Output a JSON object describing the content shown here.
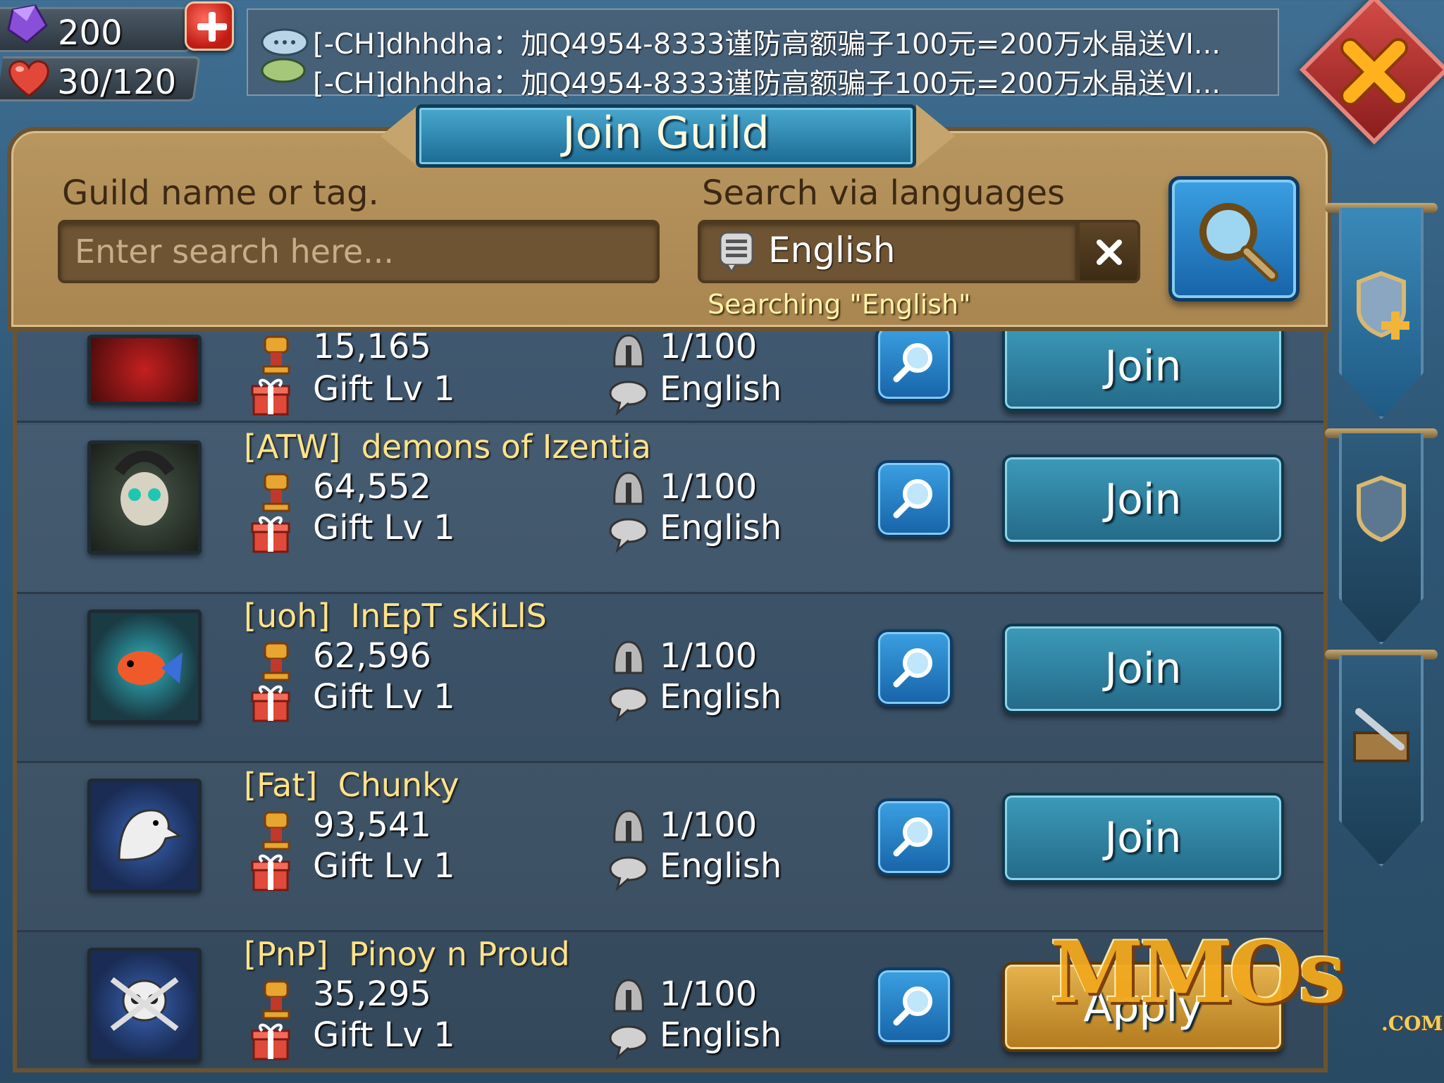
{
  "resources": {
    "gems": "200",
    "stamina": "30/120"
  },
  "chat": {
    "lines": [
      "[-CH]dhhdha：加Q4954-8333谨防高额骗子100元=200万水晶送VI...",
      "[-CH]dhhdha：加Q4954-8333谨防高额骗子100元=200万水晶送VI..."
    ]
  },
  "panel": {
    "title": "Join Guild",
    "name_label": "Guild name or tag.",
    "search_placeholder": "Enter search here...",
    "language_label": "Search via languages",
    "language_value": "English",
    "searching_status": "Searching \"English\""
  },
  "guilds": [
    {
      "tag": "",
      "name": "",
      "might": "15,165",
      "members": "1/100",
      "gift": "Gift Lv 1",
      "language": "English",
      "action": "Join"
    },
    {
      "tag": "[ATW]",
      "name": "demons of Izentia",
      "might": "64,552",
      "members": "1/100",
      "gift": "Gift Lv 1",
      "language": "English",
      "action": "Join"
    },
    {
      "tag": "[uoh]",
      "name": "InEpT sKiLlS",
      "might": "62,596",
      "members": "1/100",
      "gift": "Gift Lv 1",
      "language": "English",
      "action": "Join"
    },
    {
      "tag": "[Fat]",
      "name": "Chunky",
      "might": "93,541",
      "members": "1/100",
      "gift": "Gift Lv 1",
      "language": "English",
      "action": "Join"
    },
    {
      "tag": "[PnP]",
      "name": "Pinoy n Proud",
      "might": "35,295",
      "members": "1/100",
      "gift": "Gift Lv 1",
      "language": "English",
      "action": "Apply"
    }
  ],
  "colors": {
    "accent_blue": "#246a88",
    "panel_tan": "#b8965f",
    "guild_name_yellow": "#ffe38a",
    "apply_gold": "#e6b34e"
  },
  "icons": {
    "gem": "purple-gem-icon",
    "stamina": "heart-icon",
    "might": "fist-trophy-icon",
    "members": "helmet-icon",
    "gift": "gift-icon",
    "language": "speech-bubble-icon",
    "view": "magnifier-icon"
  },
  "watermark": {
    "text": "MMOs",
    "domain": ".COM"
  }
}
